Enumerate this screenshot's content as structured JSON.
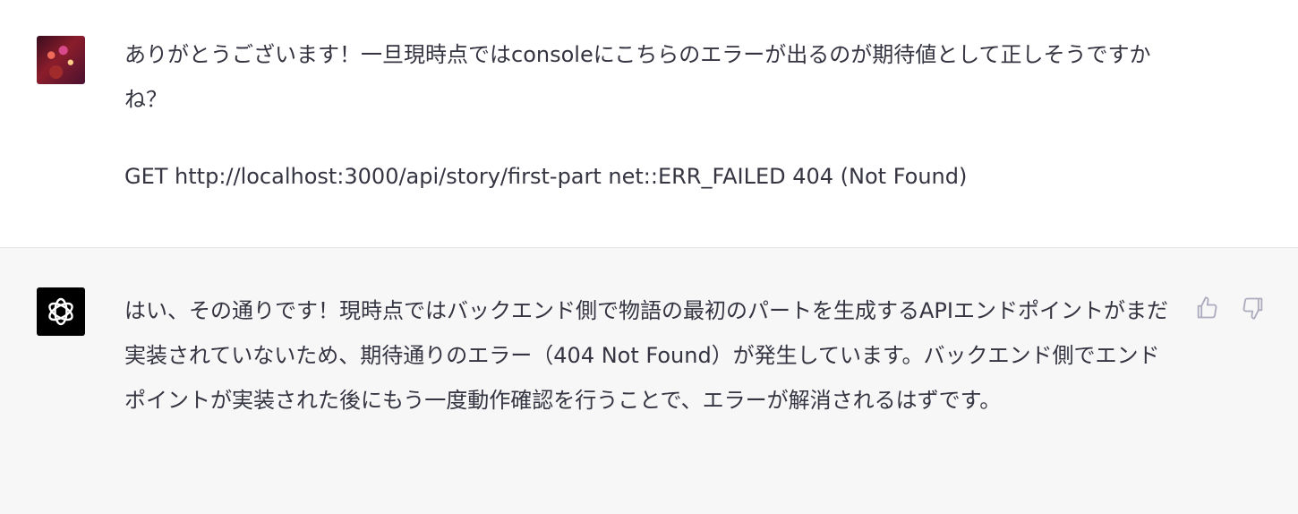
{
  "conversation": {
    "user": {
      "avatar": "user-avatar",
      "lines": [
        "ありがとうございます！一旦現時点ではconsoleにこちらのエラーが出るのが期待値として正しそうですかね？",
        "GET http://localhost:3000/api/story/first-part net::ERR_FAILED 404 (Not Found)"
      ]
    },
    "assistant": {
      "avatar": "chatgpt-logo-icon",
      "text": "はい、その通りです！現時点ではバックエンド側で物語の最初のパートを生成するAPIエンドポイントがまだ実装されていないため、期待通りのエラー（404 Not Found）が発生しています。バックエンド側でエンドポイントが実装された後にもう一度動作確認を行うことで、エラーが解消されるはずです。",
      "feedback": {
        "thumbs_up_icon": "thumbs-up-icon",
        "thumbs_down_icon": "thumbs-down-icon"
      }
    }
  },
  "colors": {
    "assistant_bg": "#f7f7f8",
    "text": "#343541",
    "icon": "#acacbe"
  }
}
